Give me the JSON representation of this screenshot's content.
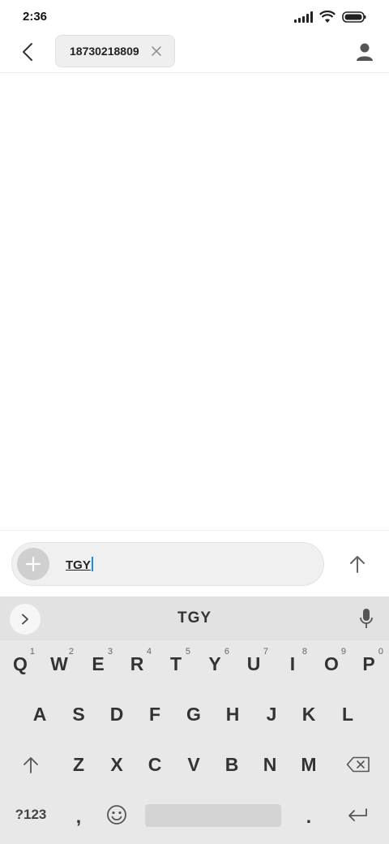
{
  "status_bar": {
    "time": "2:36",
    "icons": [
      "signal-icon",
      "wifi-icon",
      "battery-icon"
    ]
  },
  "header": {
    "back_icon": "chevron-left-icon",
    "recipient": "18730218809",
    "remove_icon": "close-icon",
    "contact_icon": "person-icon"
  },
  "compose": {
    "attach_icon": "plus-icon",
    "text": "TGY",
    "send_icon": "arrow-up-icon"
  },
  "keyboard": {
    "suggestion": "TGY",
    "expand_icon": "chevron-right-icon",
    "mic_icon": "microphone-icon",
    "row1": [
      {
        "label": "Q",
        "hint": "1"
      },
      {
        "label": "W",
        "hint": "2"
      },
      {
        "label": "E",
        "hint": "3"
      },
      {
        "label": "R",
        "hint": "4"
      },
      {
        "label": "T",
        "hint": "5"
      },
      {
        "label": "Y",
        "hint": "6"
      },
      {
        "label": "U",
        "hint": "7"
      },
      {
        "label": "I",
        "hint": "8"
      },
      {
        "label": "O",
        "hint": "9"
      },
      {
        "label": "P",
        "hint": "0"
      }
    ],
    "row2": [
      "A",
      "S",
      "D",
      "F",
      "G",
      "H",
      "J",
      "K",
      "L"
    ],
    "row3": [
      "Z",
      "X",
      "C",
      "V",
      "B",
      "N",
      "M"
    ],
    "shift_icon": "shift-arrow-icon",
    "backspace_icon": "backspace-icon",
    "symbols_label": "?123",
    "comma_label": ",",
    "emoji_icon": "emoji-icon",
    "period_label": ".",
    "enter_icon": "enter-icon"
  },
  "colors": {
    "caret": "#1e88e5",
    "keyboard_bg": "#e8e8e8",
    "chip_bg": "#efefef"
  }
}
